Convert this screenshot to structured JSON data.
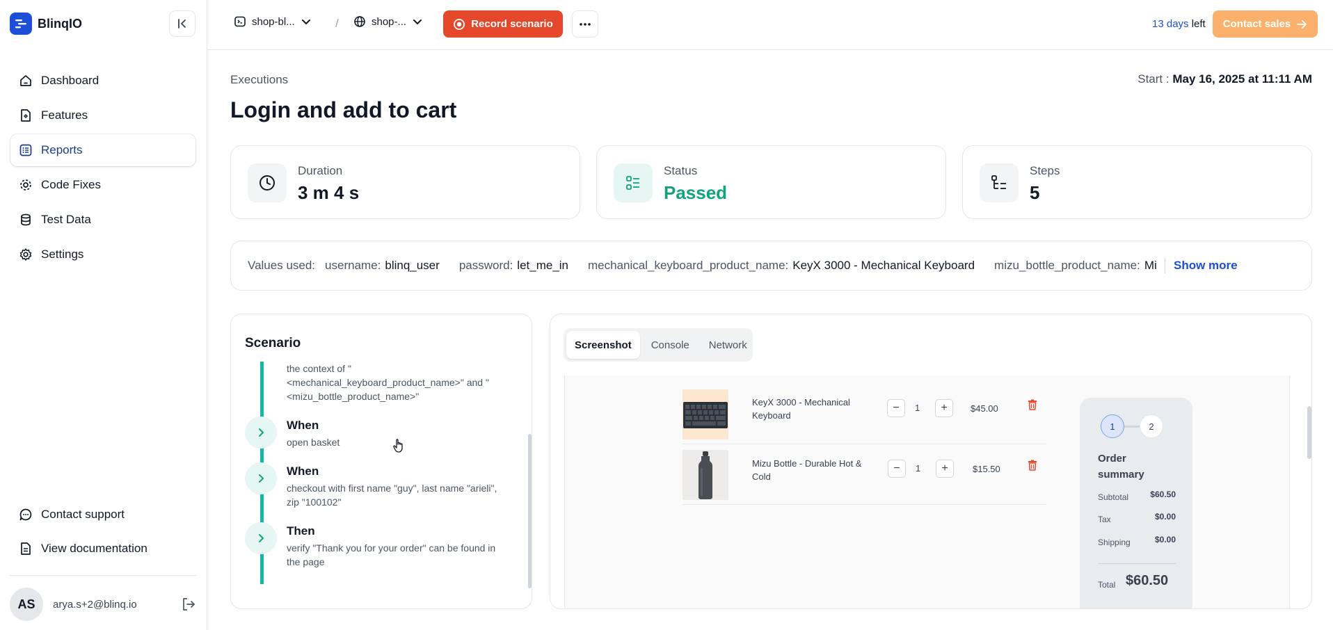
{
  "app": {
    "name": "BlinqIO"
  },
  "sidebar": {
    "nav": [
      {
        "label": "Dashboard",
        "icon": "home-icon"
      },
      {
        "label": "Features",
        "icon": "features-icon"
      },
      {
        "label": "Reports",
        "icon": "reports-icon",
        "active": true
      },
      {
        "label": "Code Fixes",
        "icon": "gear-icon"
      },
      {
        "label": "Test Data",
        "icon": "database-icon"
      },
      {
        "label": "Settings",
        "icon": "settings-icon"
      }
    ],
    "bottom": [
      {
        "label": "Contact support",
        "icon": "chat-icon"
      },
      {
        "label": "View documentation",
        "icon": "document-icon"
      }
    ],
    "user": {
      "initials": "AS",
      "email": "arya.s+2@blinq.io"
    }
  },
  "topbar": {
    "project": "shop-bl...",
    "environment": "shop-...",
    "separator": "/",
    "record_label": "Record scenario",
    "trial_days": "13 days",
    "trial_suffix": " left",
    "contact_label": "Contact sales"
  },
  "page": {
    "breadcrumb": "Executions",
    "title": "Login and add to cart",
    "start_label": "Start :",
    "start_value": "May 16, 2025 at 11:11 AM"
  },
  "stats": {
    "duration": {
      "label": "Duration",
      "value": "3 m 4 s"
    },
    "status": {
      "label": "Status",
      "value": "Passed"
    },
    "steps": {
      "label": "Steps",
      "value": "5"
    }
  },
  "values": {
    "label": "Values used:",
    "items": [
      {
        "key": "username:",
        "value": "blinq_user"
      },
      {
        "key": "password:",
        "value": "let_me_in"
      },
      {
        "key": "mechanical_keyboard_product_name:",
        "value": "KeyX 3000 - Mechanical Keyboard"
      },
      {
        "key": "mizu_bottle_product_name:",
        "value": "Mizu B"
      }
    ],
    "show_more": "Show more"
  },
  "scenario": {
    "title": "Scenario",
    "partial_text": "the context of \"<mechanical_keyboard_product_name>\" and \"<mizu_bottle_product_name>\"",
    "steps": [
      {
        "keyword": "When",
        "text": "open basket"
      },
      {
        "keyword": "When",
        "text": "checkout with first name \"guy\", last name \"arieli\", zip \"100102\""
      },
      {
        "keyword": "Then",
        "text": "verify \"Thank you for your order\" can be found in the page"
      }
    ]
  },
  "viewer": {
    "tabs": [
      "Screenshot",
      "Console",
      "Network"
    ],
    "active_tab": "Screenshot"
  },
  "screenshot": {
    "cart": [
      {
        "name": "KeyX 3000 - Mechanical Keyboard",
        "qty": "1",
        "price": "$45.00",
        "minus": "−",
        "plus": "+"
      },
      {
        "name": "Mizu Bottle - Durable Hot & Cold",
        "qty": "1",
        "price": "$15.50",
        "minus": "−",
        "plus": "+"
      }
    ],
    "summary": {
      "step1": "1",
      "step2": "2",
      "title": "Order summary",
      "subtotal_label": "Subtotal",
      "subtotal": "$60.50",
      "tax_label": "Tax",
      "tax": "$0.00",
      "shipping_label": "Shipping",
      "shipping": "$0.00",
      "total_label": "Total",
      "total": "$60.50"
    }
  },
  "colors": {
    "brand": "#1d4ed8",
    "record": "#e4472a",
    "contact": "#fbb16b",
    "passed": "#10a37f",
    "timeline": "#14b8a6"
  }
}
